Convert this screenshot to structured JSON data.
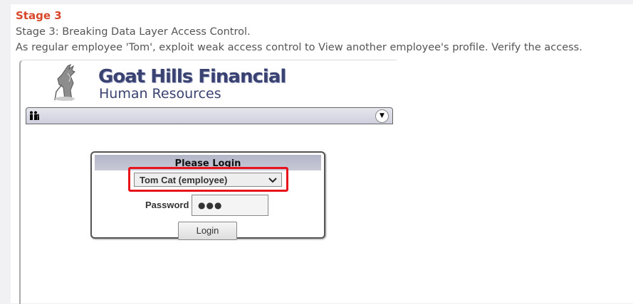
{
  "stage": {
    "heading": "Stage 3",
    "description": "Stage 3: Breaking Data Layer Access Control.",
    "instruction": "As regular employee 'Tom', exploit weak access control to View another employee's profile. Verify the access."
  },
  "app": {
    "logo_title": "Goat Hills Financial",
    "logo_subtitle": "Human Resources"
  },
  "login": {
    "header": "Please Login",
    "selected_user": "Tom Cat (employee)",
    "password_label": "Password",
    "password_mask": "●●●",
    "login_button": "Login"
  },
  "colors": {
    "accent_heading": "#d9472b",
    "highlight": "#e8141c",
    "brand": "#3a4272"
  },
  "icons": {
    "menu": "people-icon",
    "dropdown": "chevron-down-icon"
  }
}
